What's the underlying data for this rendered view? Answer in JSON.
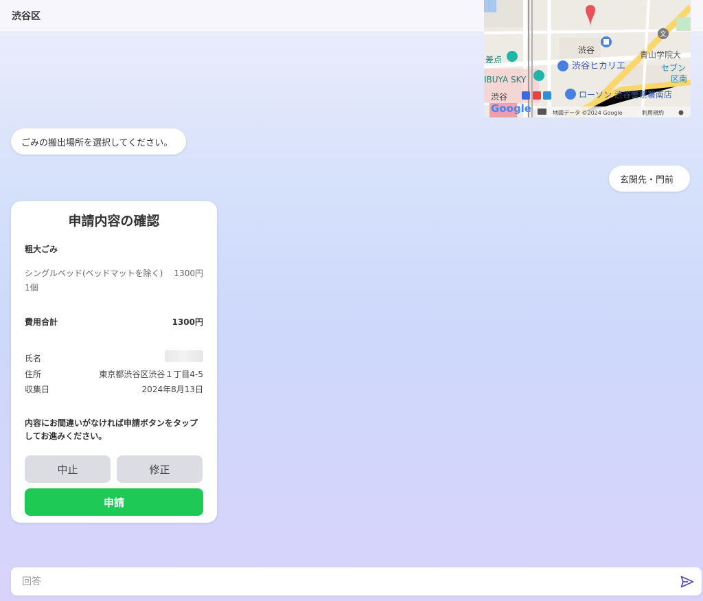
{
  "header": {
    "title": "渋谷区"
  },
  "map": {
    "labels": {
      "shibuya": "渋谷",
      "aoyama": "青山学院大",
      "seven": "セブン",
      "ku_minami": "区南",
      "hikarie": "渋谷ヒカリエ",
      "kousaten": "差点",
      "shibuya_sky": "IBUYA SKY",
      "shibuya_station": "渋谷",
      "lawson": "ローソン 渋谷警察署南店",
      "bun_icon": "文"
    },
    "google": "Google",
    "attribution": "地図データ ©2024 Google",
    "terms": "利用規約"
  },
  "chat": {
    "bot_message": "ごみの搬出場所を選択してください。",
    "user_message": "玄関先・門前"
  },
  "confirm": {
    "title": "申請内容の確認",
    "section": "粗大ごみ",
    "item_name": "シングルベッド(ベッドマットを除く)",
    "item_price": "1300円",
    "item_qty": "1個",
    "total_label": "費用合計",
    "total_value": "1300円",
    "name_label": "氏名",
    "address_label": "住所",
    "address_value": "東京都渋谷区渋谷１丁目4-5",
    "date_label": "収集日",
    "date_value": "2024年8月13日",
    "note": "内容にお間違いがなければ申請ボタンをタップしてお進みください。",
    "cancel_label": "中止",
    "edit_label": "修正",
    "apply_label": "申請"
  },
  "input": {
    "placeholder": "回答"
  },
  "colors": {
    "apply": "#1ec956",
    "send_icon": "#5b3fb0"
  }
}
